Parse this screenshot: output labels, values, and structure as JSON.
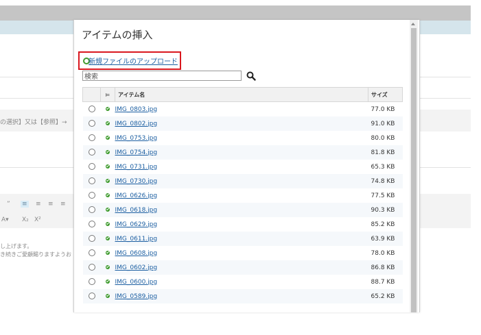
{
  "background": {
    "toolbar_row1": [
      "”",
      "≡",
      "≡",
      "≡",
      "≡"
    ],
    "toolbar_row2": [
      "A▾",
      "X₂",
      "X²"
    ],
    "text_select": "の選択】又は【参照】→",
    "text_line1": "し上げます。",
    "text_line2": "き続きご愛顧賜りますようお"
  },
  "dialog": {
    "title": "アイテムの挿入",
    "upload_link": "新規ファイルのアップロード",
    "search_value": "検索",
    "columns": {
      "flag": "⊨",
      "name": "アイテム名",
      "size": "サイズ"
    },
    "files": [
      {
        "name": "IMG_0803.jpg",
        "size": "77.0 KB"
      },
      {
        "name": "IMG_0802.jpg",
        "size": "91.0 KB"
      },
      {
        "name": "IMG_0753.jpg",
        "size": "80.0 KB"
      },
      {
        "name": "IMG_0754.jpg",
        "size": "81.8 KB"
      },
      {
        "name": "IMG_0731.jpg",
        "size": "65.3 KB"
      },
      {
        "name": "IMG_0730.jpg",
        "size": "74.8 KB"
      },
      {
        "name": "IMG_0626.jpg",
        "size": "77.5 KB"
      },
      {
        "name": "IMG_0618.jpg",
        "size": "90.3 KB"
      },
      {
        "name": "IMG_0629.jpg",
        "size": "85.2 KB"
      },
      {
        "name": "IMG_0611.jpg",
        "size": "63.9 KB"
      },
      {
        "name": "IMG_0608.jpg",
        "size": "78.0 KB"
      },
      {
        "name": "IMG_0602.jpg",
        "size": "86.8 KB"
      },
      {
        "name": "IMG_0600.jpg",
        "size": "88.7 KB"
      },
      {
        "name": "IMG_0589.jpg",
        "size": "65.2 KB"
      }
    ]
  }
}
